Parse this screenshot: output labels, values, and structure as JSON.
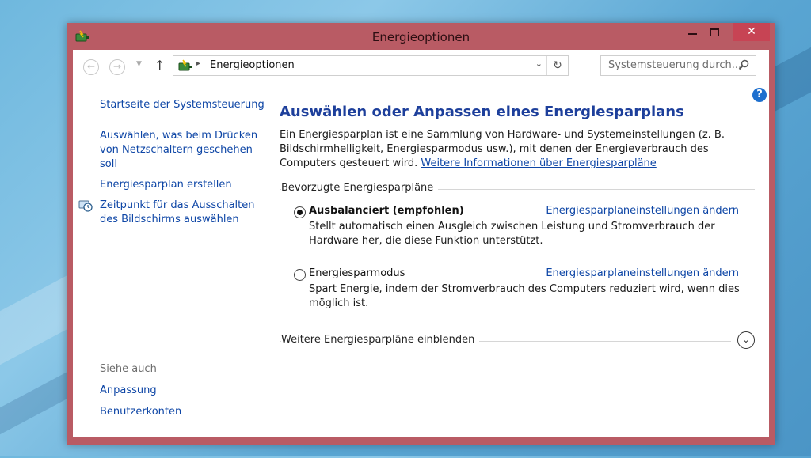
{
  "window": {
    "title": "Energieoptionen",
    "close_glyph": "✕",
    "accent": "#b95b64"
  },
  "navbar": {
    "back_glyph": "←",
    "forward_glyph": "→",
    "dropdown_glyph": "▼",
    "up_glyph": "↑",
    "address_separator": "▸",
    "address": "Energieoptionen",
    "address_chevron": "⌄",
    "refresh_glyph": "↻",
    "search_placeholder": "Systemsteuerung durch..."
  },
  "sidebar": {
    "home_link": "Startseite der Systemsteuerung",
    "items": [
      {
        "label": "Auswählen, was beim Drücken von Netzschaltern geschehen soll",
        "icon": null
      },
      {
        "label": "Energiesparplan erstellen",
        "icon": null
      },
      {
        "label": "Zeitpunkt für das Ausschalten des Bildschirms auswählen",
        "icon": "clock-shield-icon"
      }
    ],
    "see_also_label": "Siehe auch",
    "see_also": [
      {
        "label": "Anpassung"
      },
      {
        "label": "Benutzerkonten"
      }
    ]
  },
  "main": {
    "help_glyph": "?",
    "heading": "Auswählen oder Anpassen eines Energiesparplans",
    "description": "Ein Energiesparplan ist eine Sammlung von Hardware- und Systemeinstellungen (z. B. Bildschirmhelligkeit, Energiesparmodus usw.), mit denen der Energieverbrauch des Computers gesteuert wird.",
    "more_info_link": "Weitere Informationen über Energiesparpläne",
    "preferred_group_label": "Bevorzugte Energiesparpläne",
    "plans": [
      {
        "name": "Ausbalanciert (empfohlen)",
        "selected": true,
        "settings_link": "Energiesparplaneinstellungen ändern",
        "description": "Stellt automatisch einen Ausgleich zwischen Leistung und Stromverbrauch der Hardware her, die diese Funktion unterstützt."
      },
      {
        "name": "Energiesparmodus",
        "selected": false,
        "settings_link": "Energiesparplaneinstellungen ändern",
        "description": "Spart Energie, indem der Stromverbrauch des Computers reduziert wird, wenn dies möglich ist."
      }
    ],
    "show_more_label": "Weitere Energiesparpläne einblenden",
    "expand_glyph": "⌄"
  }
}
